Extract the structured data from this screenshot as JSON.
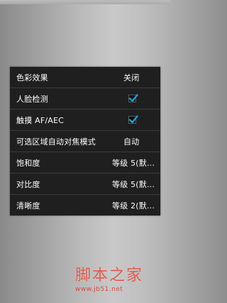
{
  "settings": {
    "rows": [
      {
        "label": "色彩效果",
        "value": "关闭"
      },
      {
        "label": "人脸检测",
        "checked": true
      },
      {
        "label": "触摸 AF/AEC",
        "checked": true
      },
      {
        "label": "可选区域自动对焦模式",
        "value": "自动"
      },
      {
        "label": "饱和度",
        "value": "等级 5(默..."
      },
      {
        "label": "对比度",
        "value": "等级 5(默..."
      },
      {
        "label": "清晰度",
        "value": "等级 2(默..."
      }
    ]
  },
  "watermark": {
    "brand": "脚本之家",
    "url": "www.jb51.net"
  },
  "colors": {
    "panel": "#1f1f1f",
    "check_accent": "#1e9fd6",
    "watermark": "#e0574b"
  }
}
